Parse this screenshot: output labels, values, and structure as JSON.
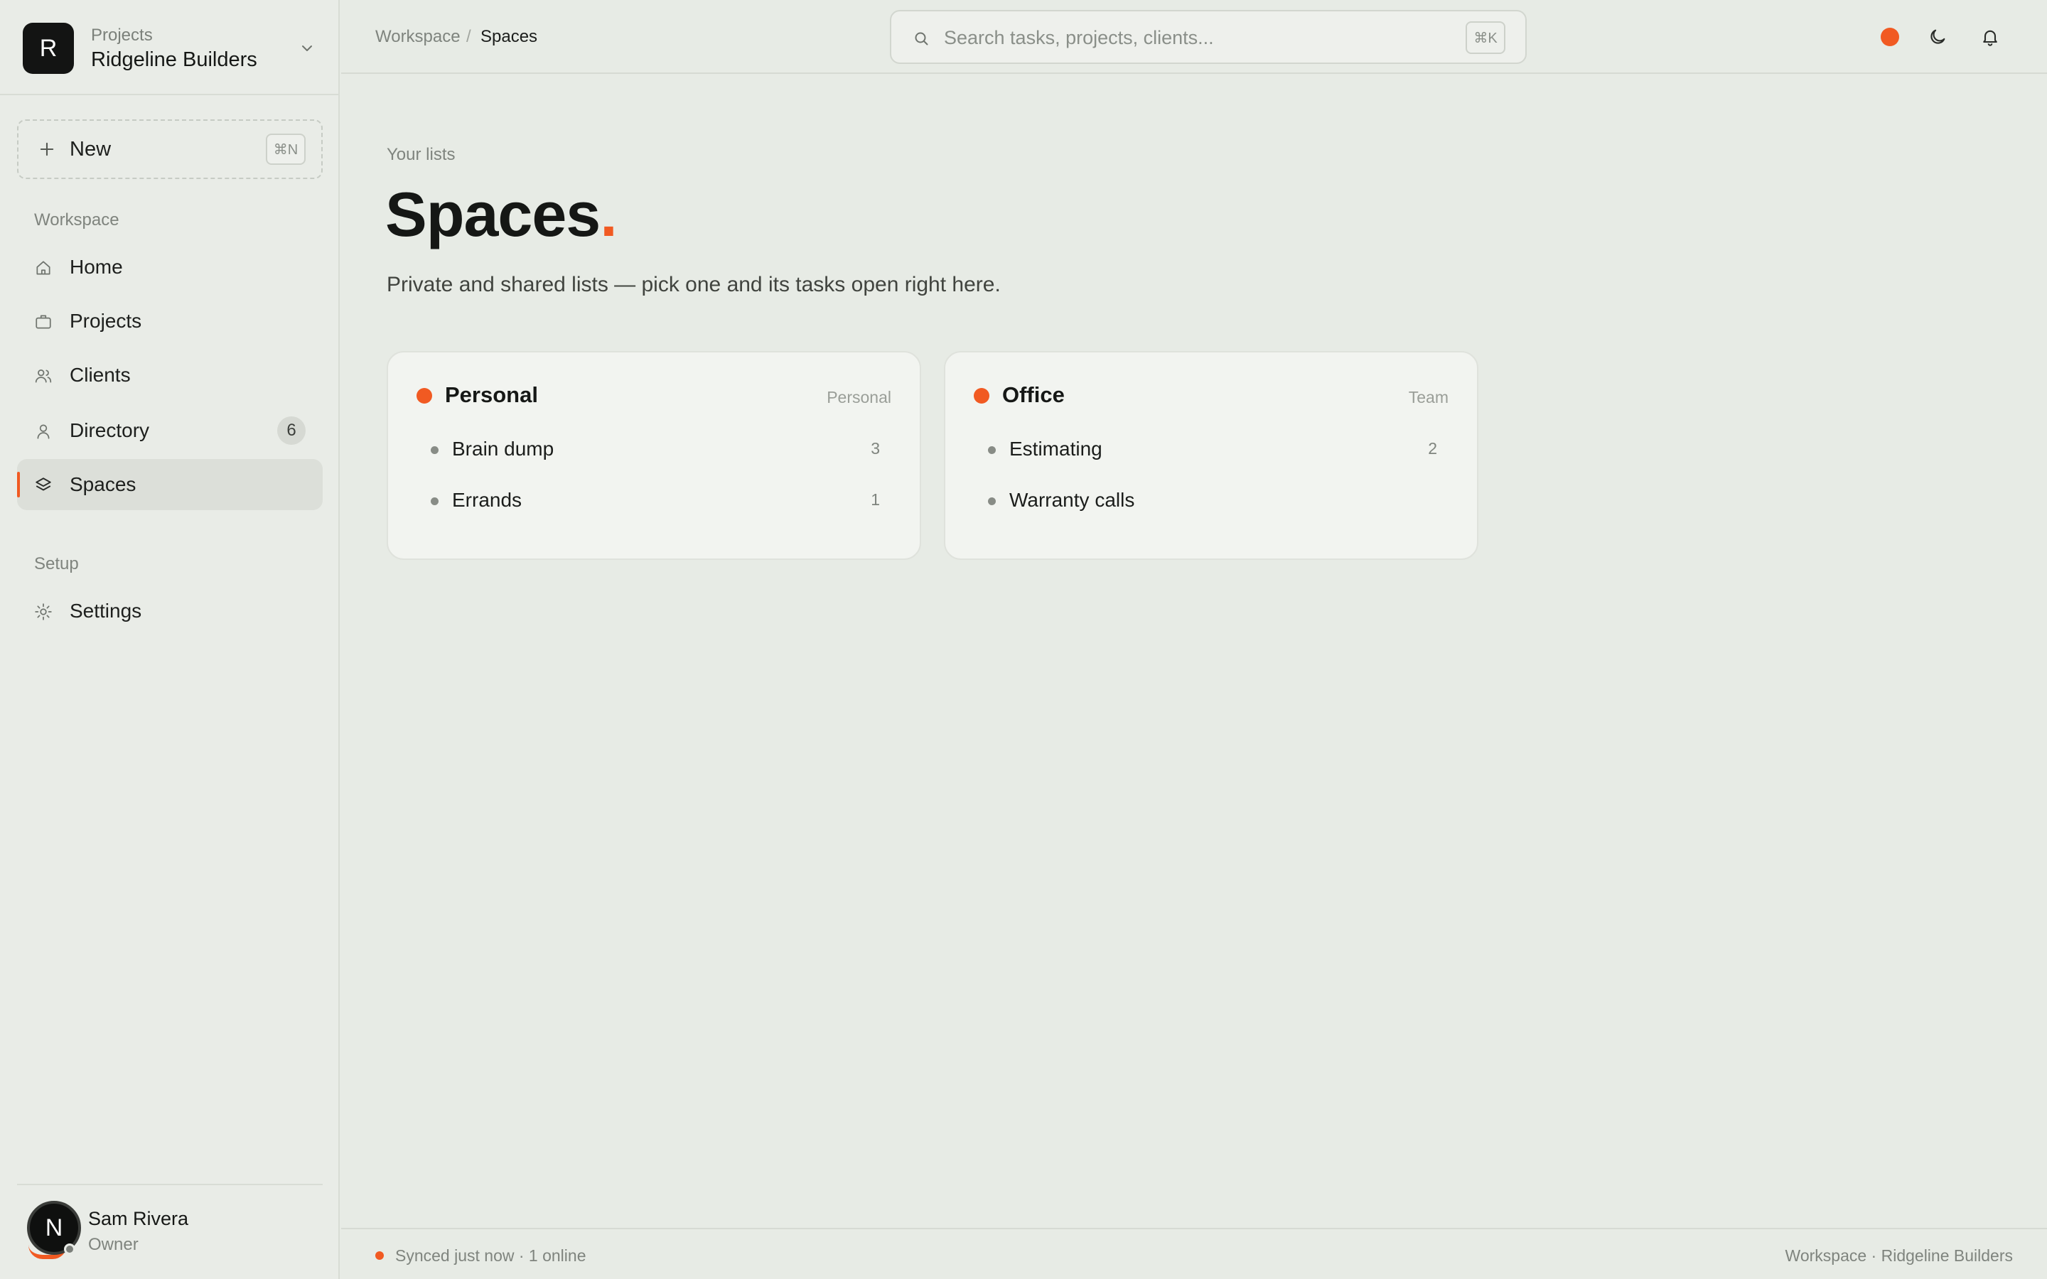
{
  "workspace": {
    "logo_letter": "R",
    "kicker": "Projects",
    "name": "Ridgeline Builders",
    "switch_icon": "chevron-down-icon"
  },
  "new_button": {
    "label": "New",
    "shortcut": "⌘N",
    "icon": "plus-icon"
  },
  "sidebar": {
    "workspace_section": "Workspace",
    "items": [
      {
        "label": "Home",
        "icon": "home-icon",
        "active": false
      },
      {
        "label": "Projects",
        "icon": "briefcase-icon",
        "active": false
      },
      {
        "label": "Clients",
        "icon": "users-icon",
        "active": false
      },
      {
        "label": "Directory",
        "icon": "user-icon",
        "badge": "6",
        "active": false
      },
      {
        "label": "Spaces",
        "icon": "layers-icon",
        "active": true
      }
    ],
    "setup_section": "Setup",
    "setup_items": [
      {
        "label": "Settings",
        "icon": "gear-icon"
      }
    ]
  },
  "user": {
    "initial": "N",
    "name": "Sam Rivera",
    "role": "Owner"
  },
  "breadcrumb": {
    "parent": "Workspace",
    "separator": "/",
    "current": "Spaces"
  },
  "search": {
    "placeholder": "Search tasks, projects, clients...",
    "value": "",
    "shortcut": "⌘K"
  },
  "header_icons": [
    "status-dot",
    "moon-icon",
    "bell-icon"
  ],
  "main": {
    "kicker": "Your lists",
    "title": "Spaces",
    "title_accent": ".",
    "subtitle": "Private and shared lists — pick one and its tasks open right here."
  },
  "spaces": [
    {
      "title": "Personal",
      "tag": "Personal",
      "lists": [
        {
          "label": "Brain dump",
          "count": "3"
        },
        {
          "label": "Errands",
          "count": "1"
        }
      ]
    },
    {
      "title": "Office",
      "tag": "Team",
      "lists": [
        {
          "label": "Estimating",
          "count": "2"
        },
        {
          "label": "Warranty calls",
          "count": ""
        }
      ]
    }
  ],
  "footer": {
    "left": "Synced just now · 1 online",
    "right": "Workspace · Ridgeline Builders"
  },
  "colors": {
    "accent": "#f15a22",
    "background": "#e7ebe5",
    "card": "#f2f4f0",
    "text": "#1b1d1b"
  }
}
